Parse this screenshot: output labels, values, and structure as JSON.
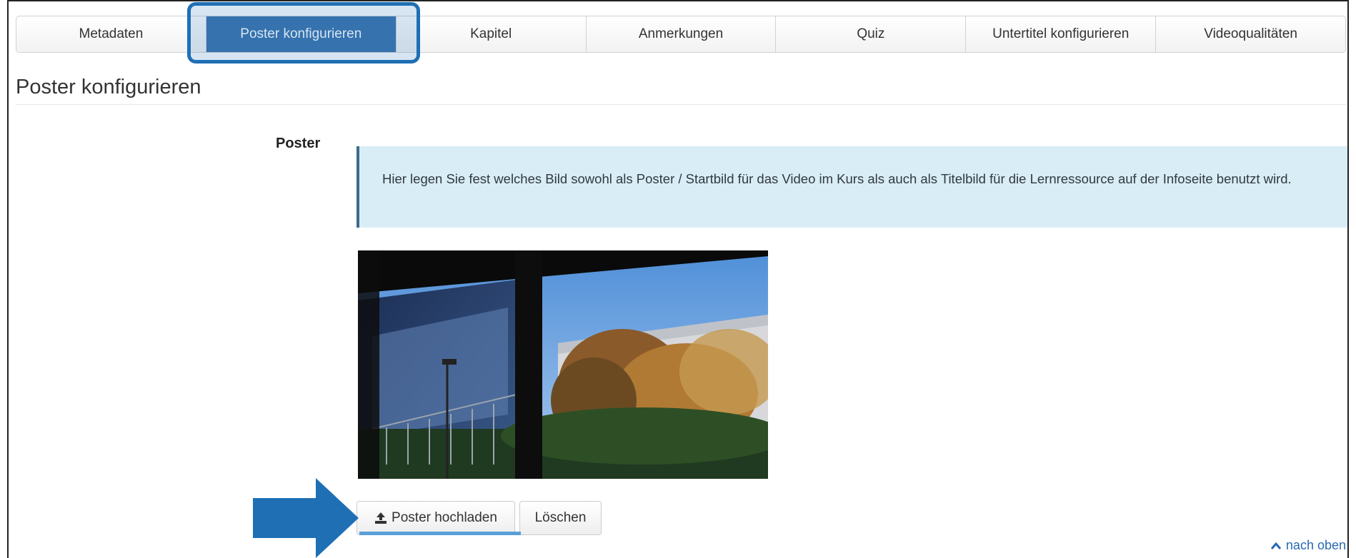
{
  "tabs": [
    {
      "label": "Metadaten"
    },
    {
      "label": "Poster konfigurieren"
    },
    {
      "label": "Kapitel"
    },
    {
      "label": "Anmerkungen"
    },
    {
      "label": "Quiz"
    },
    {
      "label": "Untertitel konfigurieren"
    },
    {
      "label": "Videoqualitäten"
    }
  ],
  "active_tab_index": 1,
  "page_title": "Poster konfigurieren",
  "poster": {
    "field_label": "Poster",
    "info_text": "Hier legen Sie fest welches Bild sowohl als Poster / Startbild für das Video im Kurs als auch als Titelbild für die Lernressource auf der Infoseite benutzt wird.",
    "image_description_icon": "poster-image",
    "upload_label": "Poster hochladen",
    "delete_label": "Löschen"
  },
  "footer": {
    "to_top_label": "nach oben"
  },
  "colors": {
    "active_tab": "#3a73ad",
    "highlight": "#1f6fb5",
    "info_bg": "#d9edf7",
    "link": "#2a6ab2"
  }
}
